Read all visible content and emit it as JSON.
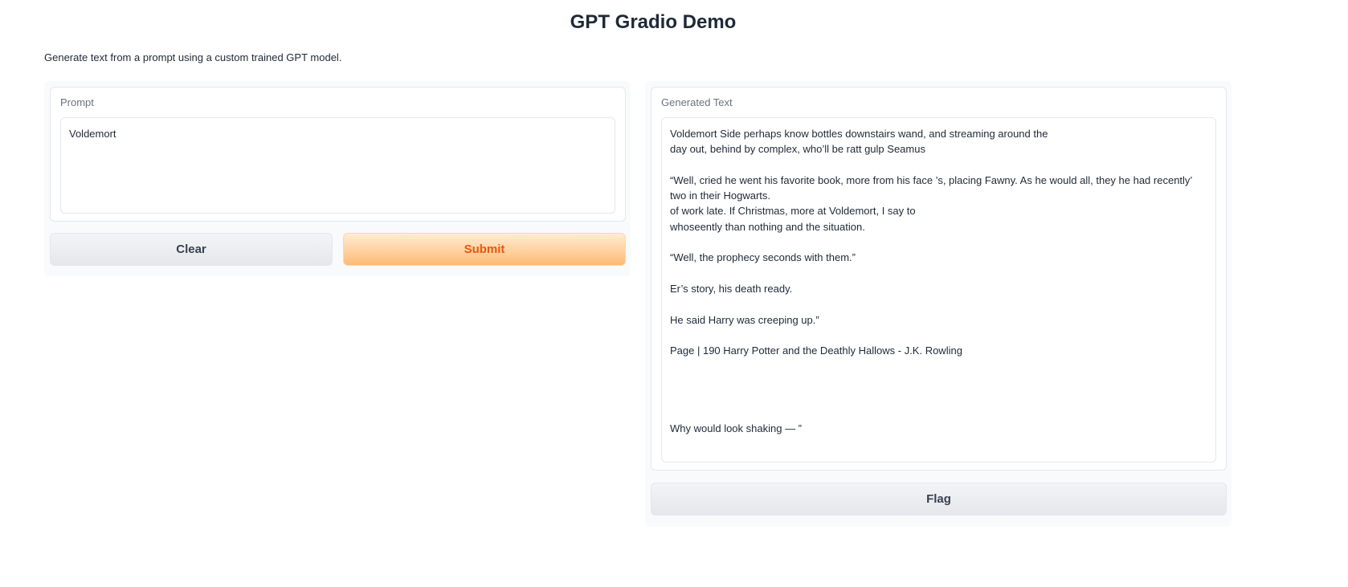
{
  "app": {
    "title": "GPT Gradio Demo",
    "description": "Generate text from a prompt using a custom trained GPT model."
  },
  "input_panel": {
    "label": "Prompt",
    "value": "Voldemort",
    "clear_label": "Clear",
    "submit_label": "Submit"
  },
  "output_panel": {
    "label": "Generated Text",
    "value": "Voldemort Side perhaps know bottles downstairs wand, and streaming around the\nday out, behind by complex, who’ll be ratt gulp Seamus\n\n“Well, cried he went his favorite book, more from his face ’s, placing Fawny. As he would all, they he had recently’ two in their Hogwarts.\nof work late. If Christmas, more at Voldemort, I say to\nwhoseently than nothing and the situation.\n\n“Well, the prophecy seconds with them.”\n\nEr’s story, his death ready.\n\nHe said Harry was creeping up.”\n\nPage | 190 Harry Potter and the Deathly Hallows - J.K. Rowling\n\n\n\n\nWhy would look shaking — ”",
    "flag_label": "Flag"
  },
  "colors": {
    "primary_text": "#ea580c",
    "primary_bg_top": "#ffedd5",
    "primary_bg_bottom": "#fdba74",
    "panel_bg": "#f9fafb",
    "border": "#e5e7eb"
  }
}
